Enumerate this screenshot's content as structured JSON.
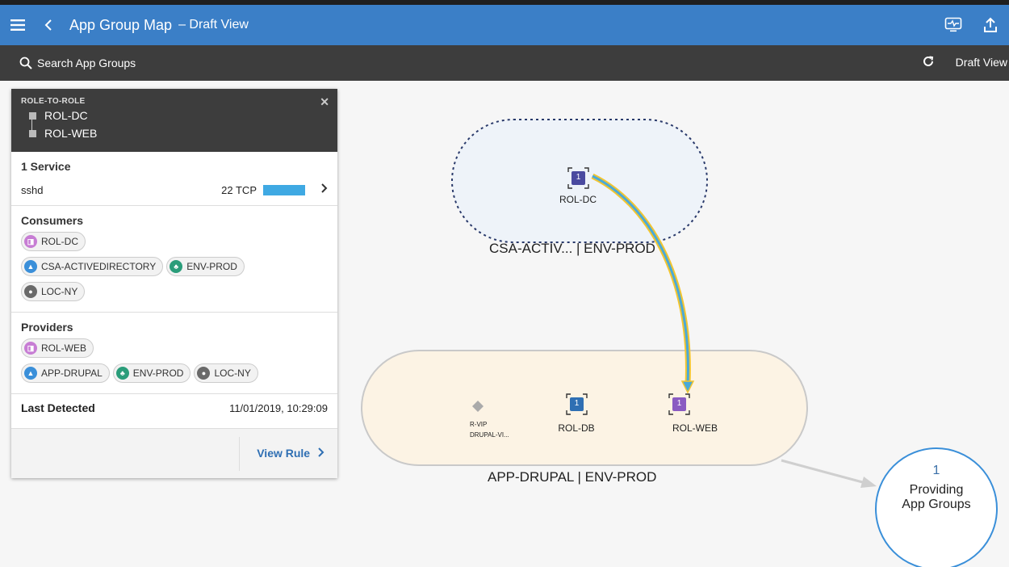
{
  "header": {
    "title": "App Group Map",
    "subtitle": "– Draft View"
  },
  "searchbar": {
    "placeholder": "Search App Groups",
    "view_mode": "Draft View"
  },
  "panel": {
    "kind": "ROLE-TO-ROLE",
    "from_role": "ROL-DC",
    "to_role": "ROL-WEB",
    "services_title": "1 Service",
    "service": {
      "name": "sshd",
      "port": "22 TCP"
    },
    "consumers_title": "Consumers",
    "consumers": [
      {
        "type": "role",
        "label": "ROL-DC"
      },
      {
        "type": "app",
        "label": "CSA-ACTIVEDIRECTORY"
      },
      {
        "type": "env",
        "label": "ENV-PROD"
      },
      {
        "type": "loc",
        "label": "LOC-NY"
      }
    ],
    "providers_title": "Providers",
    "providers": [
      {
        "type": "role",
        "label": "ROL-WEB"
      },
      {
        "type": "app",
        "label": "APP-DRUPAL"
      },
      {
        "type": "env",
        "label": "ENV-PROD"
      },
      {
        "type": "loc",
        "label": "LOC-NY"
      }
    ],
    "last_detected_label": "Last Detected",
    "last_detected_value": "11/01/2019, 10:29:09",
    "view_rule": "View Rule"
  },
  "map": {
    "group_top_label": "CSA-ACTIV... | ENV-PROD",
    "group_bottom_label": "APP-DRUPAL | ENV-PROD",
    "node_dc": {
      "count": "1",
      "label": "ROL-DC"
    },
    "node_db": {
      "count": "1",
      "label": "ROL-DB"
    },
    "node_web": {
      "count": "1",
      "label": "ROL-WEB"
    },
    "vip_label_1": "R-VIP",
    "vip_label_2": "DRUPAL-VI...",
    "providing_count": "1",
    "providing_label_1": "Providing",
    "providing_label_2": "App Groups"
  },
  "colors": {
    "topbar": "#3b7fc7",
    "searchbar": "#3d3d3d",
    "node_dc": "#4a4aa0",
    "node_db": "#2f6fb3",
    "node_web": "#8a5bc2",
    "link_outer": "#f2c531",
    "link_inner": "#4aa9d8"
  },
  "icons": [
    "menu-icon",
    "back-icon",
    "monitor-icon",
    "upload-icon",
    "search-icon",
    "refresh-icon",
    "close-icon",
    "chevron-right-icon"
  ]
}
